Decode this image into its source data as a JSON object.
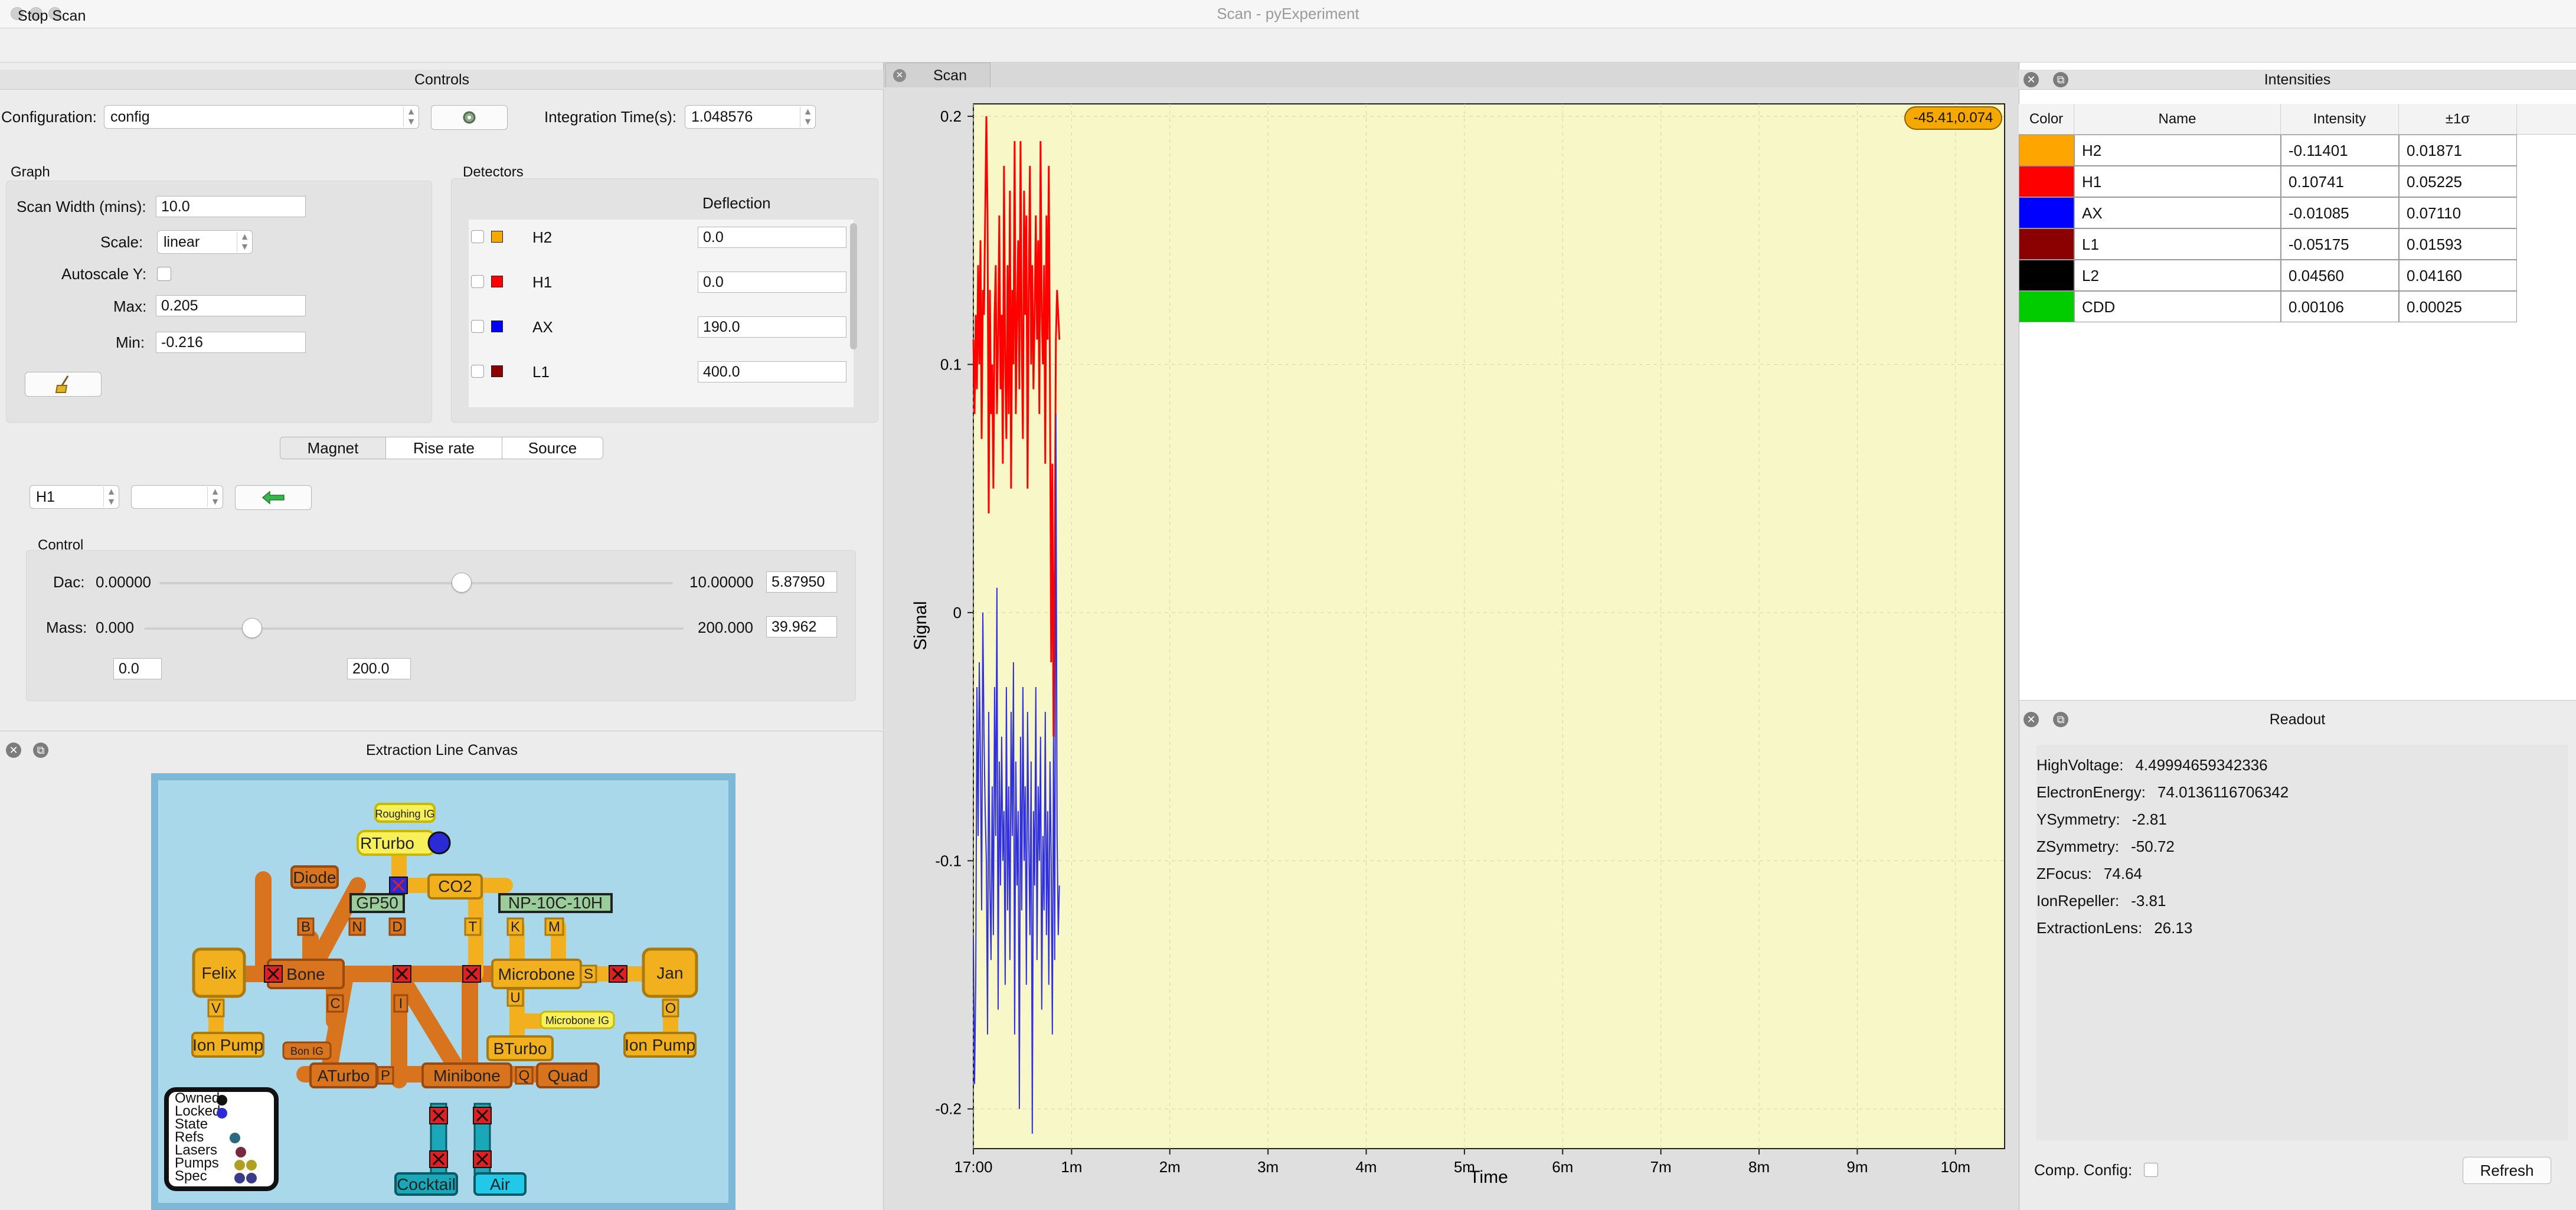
{
  "window": {
    "title": "Scan - pyExperiment"
  },
  "toolbar": {
    "stop_scan": "Stop Scan"
  },
  "controls": {
    "title": "Controls",
    "configuration_label": "Configuration:",
    "configuration_value": "config",
    "integration_label": "Integration Time(s):",
    "integration_value": "1.048576",
    "graph": {
      "title": "Graph",
      "scan_width_label": "Scan Width (mins):",
      "scan_width_value": "10.0",
      "scale_label": "Scale:",
      "scale_value": "linear",
      "autoscale_label": "Autoscale Y:",
      "max_label": "Max:",
      "max_value": "0.205",
      "min_label": "Min:",
      "min_value": "-0.216"
    },
    "detectors": {
      "title": "Detectors",
      "column": "Deflection",
      "rows": [
        {
          "name": "H2",
          "value": "0.0",
          "color": "#f5a800"
        },
        {
          "name": "H1",
          "value": "0.0",
          "color": "#ff0000"
        },
        {
          "name": "AX",
          "value": "190.0",
          "color": "#0000ff"
        },
        {
          "name": "L1",
          "value": "400.0",
          "color": "#8b0000"
        }
      ]
    },
    "tabs": [
      "Magnet",
      "Rise rate",
      "Source"
    ],
    "magnet": {
      "detector_value": "H1",
      "control_title": "Control",
      "dac_label": "Dac:",
      "dac_min": "0.00000",
      "dac_max": "10.00000",
      "dac_value": "5.87950",
      "dac_fraction": 0.588,
      "mass_label": "Mass:",
      "mass_min": "0.000",
      "mass_max": "200.000",
      "mass_value": "39.962",
      "mass_fraction": 0.2,
      "range_low": "0.0",
      "range_high": "200.0"
    }
  },
  "extraction": {
    "title": "Extraction Line Canvas",
    "labels": {
      "roughing": "Roughing IG",
      "rturbo": "RTurbo",
      "diode": "Diode",
      "co2": "CO2",
      "gp50": "GP50",
      "np": "NP-10C-10H",
      "felix": "Felix",
      "bone": "Bone",
      "microbone": "Microbone",
      "jan": "Jan",
      "ion_pump_left": "Ion Pump",
      "ion_pump_right": "Ion Pump",
      "bone_ig": "Bon IG",
      "microbone_ig": "Microbone IG",
      "bturbo": "BTurbo",
      "aturbo": "ATurbo",
      "minibone": "Minibone",
      "quad": "Quad",
      "cocktail": "Cocktail",
      "air": "Air",
      "valve_b": "B",
      "valve_n": "N",
      "valve_d": "D",
      "valve_t": "T",
      "valve_k": "K",
      "valve_m": "M",
      "valve_s": "S",
      "valve_u": "U",
      "valve_c": "C",
      "valve_i": "I",
      "valve_v": "V",
      "valve_o": "O",
      "valve_p": "P",
      "valve_q": "Q"
    },
    "legend": [
      "Owned",
      "Locked",
      "State",
      "Refs",
      "Lasers",
      "Pumps",
      "Spec"
    ]
  },
  "scan": {
    "tab": "Scan",
    "badge": "-45.41,0.074",
    "chart_data": {
      "type": "line",
      "xlabel": "Time",
      "ylabel": "Signal",
      "x_tick_labels": [
        "17:00",
        "1m",
        "2m",
        "3m",
        "4m",
        "5m",
        "6m",
        "7m",
        "8m",
        "9m",
        "10m"
      ],
      "xlim": [
        0,
        10.5
      ],
      "ylim": [
        -0.216,
        0.205
      ],
      "y_tick_labels": [
        "0.2",
        "0.1",
        "0",
        "-0.1",
        "-0.2"
      ],
      "y_ticks": [
        0.2,
        0.1,
        0,
        -0.1,
        -0.2
      ],
      "grid": true,
      "series": [
        {
          "color": "#ff0000",
          "x_start": 0.0,
          "x_step": 0.012,
          "values": [
            0.11,
            0.08,
            0.12,
            0.09,
            0.14,
            0.1,
            0.15,
            0.07,
            0.13,
            0.12,
            0.16,
            0.2,
            0.16,
            0.04,
            0.13,
            0.08,
            0.1,
            0.05,
            0.12,
            0.14,
            0.08,
            0.11,
            0.16,
            0.09,
            0.12,
            0.06,
            0.18,
            0.1,
            0.07,
            0.14,
            0.08,
            0.17,
            0.05,
            0.13,
            0.1,
            0.19,
            0.08,
            0.12,
            0.15,
            0.09,
            0.19,
            0.11,
            0.07,
            0.17,
            0.12,
            0.16,
            0.05,
            0.13,
            0.18,
            0.1,
            0.14,
            0.09,
            0.12,
            0.16,
            0.11,
            0.15,
            0.08,
            0.19,
            0.12,
            0.1,
            0.14,
            0.06,
            0.16,
            0.11,
            0.18,
            0.09,
            -0.02,
            0.06,
            -0.05,
            0.02,
            0.11,
            0.13,
            0.12,
            0.11
          ]
        },
        {
          "color": "#3030e0",
          "x_start": 0.0,
          "x_step": 0.012,
          "values": [
            -0.13,
            -0.19,
            -0.15,
            -0.03,
            -0.09,
            -0.02,
            -0.06,
            -0.12,
            0.0,
            -0.05,
            -0.08,
            -0.1,
            -0.17,
            -0.04,
            -0.11,
            -0.14,
            -0.07,
            -0.13,
            -0.03,
            -0.09,
            0.01,
            -0.16,
            -0.06,
            -0.11,
            -0.05,
            -0.1,
            -0.08,
            -0.15,
            -0.03,
            -0.12,
            -0.07,
            -0.14,
            -0.04,
            -0.09,
            -0.02,
            -0.17,
            -0.06,
            -0.11,
            -0.08,
            -0.2,
            -0.05,
            -0.12,
            -0.03,
            -0.1,
            -0.07,
            -0.15,
            -0.04,
            -0.09,
            -0.13,
            -0.06,
            -0.21,
            -0.08,
            -0.11,
            -0.03,
            -0.14,
            -0.07,
            -0.1,
            -0.05,
            -0.16,
            -0.09,
            -0.12,
            -0.04,
            -0.13,
            -0.08,
            -0.15,
            -0.06,
            -0.1,
            -0.17,
            -0.05,
            -0.14,
            0.08,
            -0.09,
            -0.13,
            -0.11
          ]
        }
      ]
    }
  },
  "intensities": {
    "title": "Intensities",
    "headers": [
      "Color",
      "Name",
      "Intensity",
      "±1σ"
    ],
    "rows": [
      {
        "color": "#ffa500",
        "name": "H2",
        "intensity": "-0.11401",
        "sigma": "0.01871"
      },
      {
        "color": "#ff0000",
        "name": "H1",
        "intensity": "0.10741",
        "sigma": "0.05225"
      },
      {
        "color": "#0000ff",
        "name": "AX",
        "intensity": "-0.01085",
        "sigma": "0.07110"
      },
      {
        "color": "#8b0000",
        "name": "L1",
        "intensity": "-0.05175",
        "sigma": "0.01593"
      },
      {
        "color": "#000000",
        "name": "L2",
        "intensity": "0.04560",
        "sigma": "0.04160"
      },
      {
        "color": "#00cc00",
        "name": "CDD",
        "intensity": "0.00106",
        "sigma": "0.00025"
      }
    ]
  },
  "readout": {
    "title": "Readout",
    "items": [
      {
        "key": "HighVoltage:",
        "value": "4.49994659342336"
      },
      {
        "key": "ElectronEnergy:",
        "value": "74.0136116706342"
      },
      {
        "key": "YSymmetry:",
        "value": "-2.81"
      },
      {
        "key": "ZSymmetry:",
        "value": "-50.72"
      },
      {
        "key": "ZFocus:",
        "value": "74.64"
      },
      {
        "key": "IonRepeller:",
        "value": "-3.81"
      },
      {
        "key": "ExtractionLens:",
        "value": "26.13"
      }
    ],
    "comp_config_label": "Comp. Config:",
    "refresh_label": "Refresh"
  }
}
